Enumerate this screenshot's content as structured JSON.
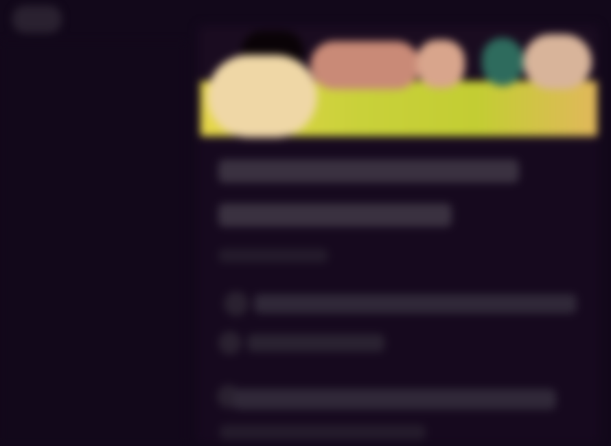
{
  "app": {
    "logo_label": ""
  },
  "banner": {
    "alt": ""
  },
  "content": {
    "title_line_1": "",
    "title_line_2": "",
    "meta": "",
    "item_1_title": "",
    "item_1_subtitle": "",
    "item_2_title": "",
    "item_2_subtitle": ""
  },
  "colors": {
    "background": "#12081a",
    "card": "#16091e",
    "banner_yellow": "#c9d13a",
    "banner_cream": "#efd7a6"
  },
  "icons": {
    "logo": "app-logo-icon"
  }
}
